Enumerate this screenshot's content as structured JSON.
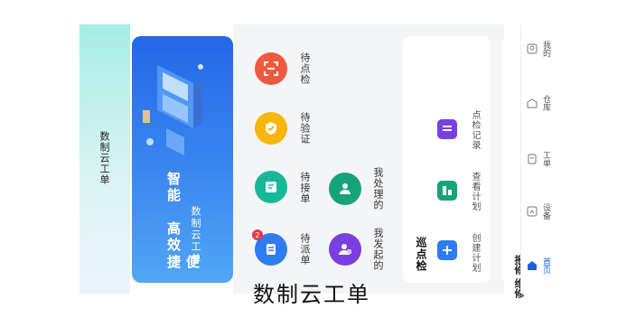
{
  "app_title": "数制云工单",
  "banner": {
    "slogans": [
      "便捷",
      "高效",
      "智能"
    ],
    "subtitle": "数制云工单"
  },
  "quick_actions": [
    {
      "label": "待点检",
      "icon": "scan-icon",
      "color": "#f0593e"
    },
    {
      "label": "待验证",
      "icon": "check-shield-icon",
      "color": "#f6b60a"
    },
    {
      "label": "待接单",
      "icon": "receive-doc-icon",
      "color": "#16b897"
    },
    {
      "label": "待派单",
      "icon": "dispatch-doc-icon",
      "color": "#2e7cf0",
      "badge": "2"
    },
    {
      "label": "我处理的",
      "icon": "handle-user-icon",
      "color": "#17a37a"
    },
    {
      "label": "我发起的",
      "icon": "initiate-user-icon",
      "color": "#7a3fe0"
    }
  ],
  "patrol": {
    "title": "巡点检",
    "items": [
      {
        "label": "创建计划",
        "icon": "add-plan-icon",
        "color": "#2e7cf0"
      },
      {
        "label": "查看计划",
        "icon": "view-plan-icon",
        "color": "#17a37a"
      },
      {
        "label": "点检记录",
        "icon": "record-icon",
        "color": "#7a3fe0"
      }
    ]
  },
  "peek_text": "报修 维修",
  "tabs": [
    {
      "label": "首页",
      "icon": "home-icon",
      "active": true
    },
    {
      "label": "设备",
      "icon": "device-icon",
      "active": false
    },
    {
      "label": "工单",
      "icon": "workorder-icon",
      "active": false
    },
    {
      "label": "仓库",
      "icon": "warehouse-icon",
      "active": false
    },
    {
      "label": "我的",
      "icon": "profile-icon",
      "active": false
    }
  ],
  "caption": "数制云工单"
}
